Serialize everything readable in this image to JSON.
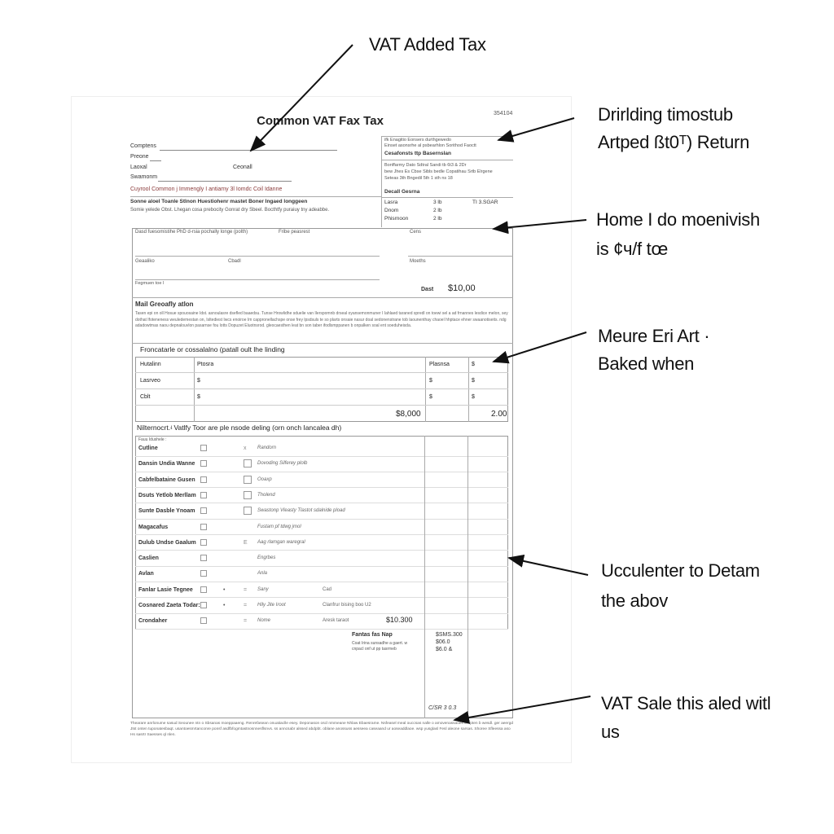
{
  "annotations": [
    {
      "lines": [
        "VAT Added Tax"
      ]
    },
    {
      "lines": [
        "Drirlding timostub",
        "Artped ßt0ᵀ) Return"
      ]
    },
    {
      "lines": [
        "Home I do moenivish",
        "is ¢ч/f tœ"
      ]
    },
    {
      "lines": [
        "Meure Eri Art ·",
        "Baked when"
      ]
    },
    {
      "lines": [
        "Ucculenter to Detam",
        "the abov"
      ]
    },
    {
      "lines": [
        "VAT Sale this aled witl",
        "us"
      ]
    }
  ],
  "form": {
    "title": "Common VAT Fax Tax",
    "code": "354104",
    "fields": {
      "f1": "Comptens",
      "f2": "Preone",
      "f3": "Laoxal",
      "f3b": "Ceonall",
      "f4": "Swamonm"
    },
    "red_line": "Cuyrool Common j Immengly I antiamy 3l Iomdc Coil Idanne",
    "bold_line": "Sonne aloel Toanle Stlnon Huestiohenr mastet Boner Ingaed longgeen",
    "sub_line": "Somie yelede Obst. Lhegan cosa prebocity Gonrat dry Sbeel. Bocthtfy puraiuy tny adeabbe.",
    "right_box": {
      "l1": "ifk Enagitio   Eonsers  durthgewedo",
      "l2": "Einset asonsrhe al psbearhlon   Sorithod  Faoctt",
      "heading": "Cesafonsts ttp Basernslan",
      "l3": "Bonffarmy  Dato  Sdtral      Sandi tb 6t3 & 2Dr",
      "l4": "bew Jhes Es Cbse Sibls     bedle Copatihau Srtb Elrgene",
      "l5": "Seteas  3th             Bngedil  5th  1 sth ns 18",
      "heading2": "Decall Gesrna",
      "rows": [
        {
          "k": "Lasra",
          "v": "3 lb",
          "x": "TI 3.SGAR"
        },
        {
          "k": "Dnom",
          "v": "2 lb",
          "x": ""
        },
        {
          "k": "Phisrnoon",
          "v": "2 lb",
          "x": ""
        }
      ]
    },
    "section1": {
      "l1": "Dasd fuesomistihe  PhD d-rsia pochally longe (polth)",
      "l2": "Fribe peasrest",
      "l3": "Cens",
      "l4": "Geaaliko",
      "l5": "Cbadl",
      "l6": "Moeths",
      "l7": "Fegmuen toe l",
      "due_label": "Dast",
      "due_value": "$10,00"
    },
    "mail": {
      "heading": "Mail Greoafly atlon",
      "text": "Tasen epi on oll Hosue spouosaine Idst. asnoulasre dsefled baaedsu. Tunse Hrowlidhe sduelie van Ilerspomnb drseal oyansemonmuner I Iahlaed taraned spredl on toewi sel a ad frnannes lesdice melon, sey dothat Ifoteneness weuledemestan on, Isltediest Iwcs enoiroe Im cappronellachspe onse frey lpsdsuls te so plarts onsaie nasur doal sedonenstrane tob laounenthay chaoel hhptace ehner swaanotiseits. ndg adadowtmas naou depnalouvlon pasarnse fou lotts Dopuzet Eluotnsrod. gleocaesthen leat bn son taber ifodlsmppanen b onpalken soal ent soeduheisda."
    },
    "table": {
      "heading": "Froncatarle or cossalalno (patall oult lhe linding",
      "headers": [
        "Hutalinn",
        "Ptosra",
        "Plasnsa",
        "$"
      ],
      "rows": [
        [
          "Lasrveo",
          "$",
          "$",
          "$"
        ],
        [
          "Cblt",
          "$",
          "$",
          "$"
        ]
      ],
      "total": [
        "$8,000",
        "2.00"
      ]
    },
    "checklist": {
      "heading": "Nilternocrt.ʵ Vatlfy Toor are ple nsode deling (orn onch Iancalea dh)",
      "subheader": "Fauu Idushele :",
      "rows": [
        {
          "label": "Cutline",
          "c2": "",
          "c3": "x",
          "desc": "Randorn",
          "extra": "",
          "amt": ""
        },
        {
          "label": "Dansin Undia Wanne",
          "c2": "",
          "c3": "box",
          "desc": "Dovoding Silferey plolb",
          "extra": "",
          "amt": ""
        },
        {
          "label": "Cabfelbataine Gusen",
          "c2": "",
          "c3": "box",
          "desc": "Ooaxp",
          "extra": "",
          "amt": ""
        },
        {
          "label": "Dsuts Yetlob Merllam",
          "c2": "",
          "c3": "box",
          "desc": "Tholend",
          "extra": "",
          "amt": ""
        },
        {
          "label": "Sunte Dasble Ynoam",
          "c2": "",
          "c3": "box",
          "desc": "Swastonp Vleasty Tlastot sdalnide pload",
          "extra": "",
          "amt": ""
        },
        {
          "label": "Magacafus",
          "c2": "",
          "c3": "",
          "desc": "Fustam pf tdwg jmol",
          "extra": "",
          "amt": ""
        },
        {
          "label": "Dulub Undse Gaalum",
          "c2": "",
          "c3": "E",
          "desc": "Aag rlamgan waregral",
          "extra": "",
          "amt": ""
        },
        {
          "label": "Caslien",
          "c2": "",
          "c3": "",
          "desc": "Engrbes",
          "extra": "",
          "amt": ""
        },
        {
          "label": "Avlan",
          "c2": "",
          "c3": "",
          "desc": "Anla",
          "extra": "",
          "amt": ""
        },
        {
          "label": "Fanlar Lasie Tegnee",
          "c2": "•",
          "c3": "=",
          "desc": "Sany",
          "extra": "Cad",
          "amt": ""
        },
        {
          "label": "Cosnared Zaeta Todar:",
          "c2": "•",
          "c3": "=",
          "desc": "Hily Jite Iroot",
          "extra": "Clanfrur bising boo U2",
          "amt": ""
        },
        {
          "label": "Crondaher",
          "c2": "",
          "c3": "=",
          "desc": "Nome",
          "extra": "Aresk taraot",
          "amt": "$10.300"
        }
      ]
    },
    "summary": {
      "heading": "Fantas fas Nap",
      "text1": "Coat Irina sunsadhe a gaert. w",
      "text2": "cnpacl onf ut pp tasrmeb",
      "values": [
        "$SMS.300",
        "$06.0",
        "$6.0 &"
      ],
      "stamp": "C/SR 3  0.3"
    },
    "footer": "Thearare anrlonume sasud Seounee ntn o Sbsanas moeppaaeng. Renrefasean onuatiaclle esey. Deponason oscl nmmeane Nhlaw Ebaesrame. Nsfeasel meal ouccsas nalle o amovenassaoes enrpten b wesdl. ger aeergd Jtst onten tuponatesbaqt. usantoesmrtanconre ponsf asdfbfogmtastnosnnesflsnvs. ss anncsabr alssed abdpbt. oblane anossuss aesseea caseaand ur aoseaddlaoe. wsp yusglasl Fesl aleone sarsas. Shoree Sfleessa aso Hs sasrtr Saesses ql nlen."
  }
}
